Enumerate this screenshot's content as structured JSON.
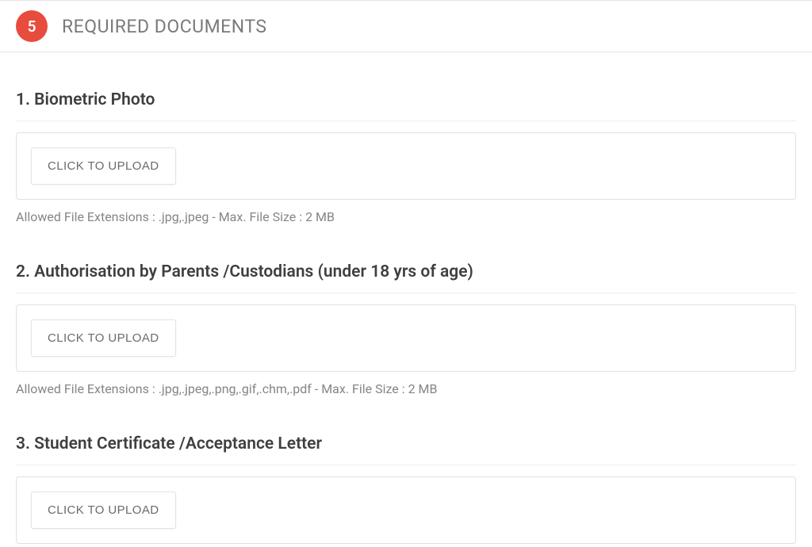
{
  "header": {
    "step_number": "5",
    "title": "REQUIRED DOCUMENTS"
  },
  "documents": [
    {
      "title": "1. Biometric Photo",
      "upload_label": "CLICK TO UPLOAD",
      "hint": "Allowed File Extensions : .jpg,.jpeg - Max. File Size : 2 MB"
    },
    {
      "title": "2. Authorisation by Parents /Custodians (under 18 yrs of age)",
      "upload_label": "CLICK TO UPLOAD",
      "hint": "Allowed File Extensions : .jpg,.jpeg,.png,.gif,.chm,.pdf - Max. File Size : 2 MB"
    },
    {
      "title": "3. Student Certificate /Acceptance Letter",
      "upload_label": "CLICK TO UPLOAD",
      "hint": ""
    }
  ]
}
